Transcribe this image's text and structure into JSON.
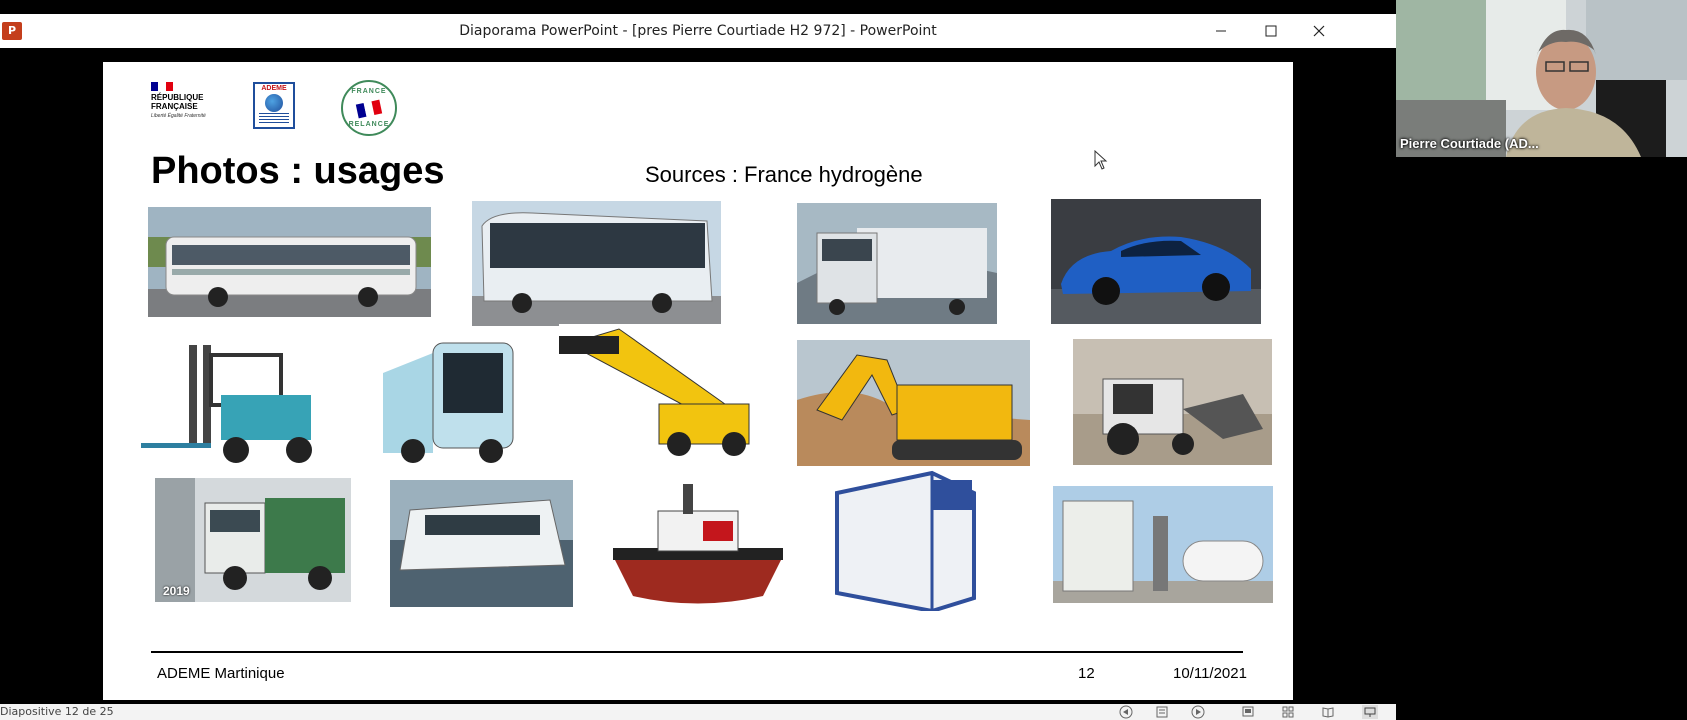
{
  "window": {
    "title": "Diaporama PowerPoint - [pres Pierre Courtiade H2 972] - PowerPoint",
    "app_icon": "P"
  },
  "slide": {
    "logos": {
      "republique": [
        "RÉPUBLIQUE",
        "FRANÇAISE"
      ],
      "republique_motto": "Liberté Égalité Fraternité",
      "ademe": "ADEME",
      "relance_top": "FRANCE",
      "relance_bottom": "RELANCE"
    },
    "title": "Photos : usages",
    "sources": "Sources : France hydrogène",
    "photo_year_label": "2019",
    "footer": {
      "left": "ADEME Martinique",
      "page": "12",
      "date": "10/11/2021"
    }
  },
  "statusbar": {
    "slide_counter": "Diapositive 12 de 25"
  },
  "webcam": {
    "participant_name": "Pierre Courtiade (AD..."
  },
  "colors": {
    "flag_blue": "#000091",
    "flag_red": "#e1000f",
    "ademe_blue": "#1f4e9c",
    "relance_green": "#3f8a5a",
    "ppt_orange": "#c43e1c"
  },
  "icons": [
    "powerpoint-app-icon",
    "minimize-icon",
    "maximize-icon",
    "close-icon",
    "previous-icon",
    "menu-icon",
    "next-icon",
    "normal-view-icon",
    "slide-sorter-icon",
    "reading-view-icon",
    "slideshow-icon",
    "mouse-cursor-icon"
  ]
}
